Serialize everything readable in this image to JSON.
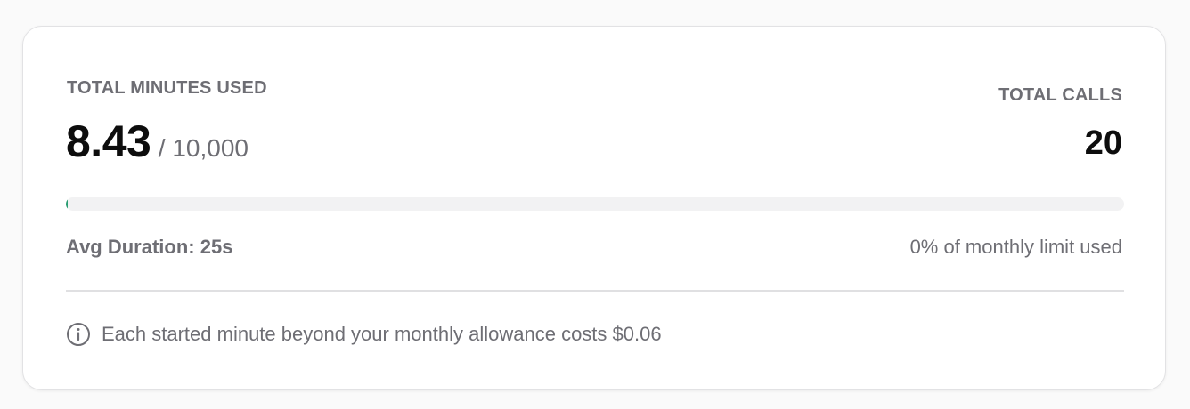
{
  "usage": {
    "minutes_label": "TOTAL MINUTES USED",
    "minutes_used": "8.43",
    "minutes_limit": "/ 10,000",
    "calls_label": "TOTAL CALLS",
    "calls_count": "20",
    "progress_fraction": 0.00084,
    "progress_color": "#2a9d72",
    "avg_duration": "Avg Duration: 25s",
    "limit_used_text": "0% of monthly limit used"
  },
  "note": {
    "icon": "info-icon",
    "text": "Each started minute beyond your monthly allowance costs $0.06"
  }
}
